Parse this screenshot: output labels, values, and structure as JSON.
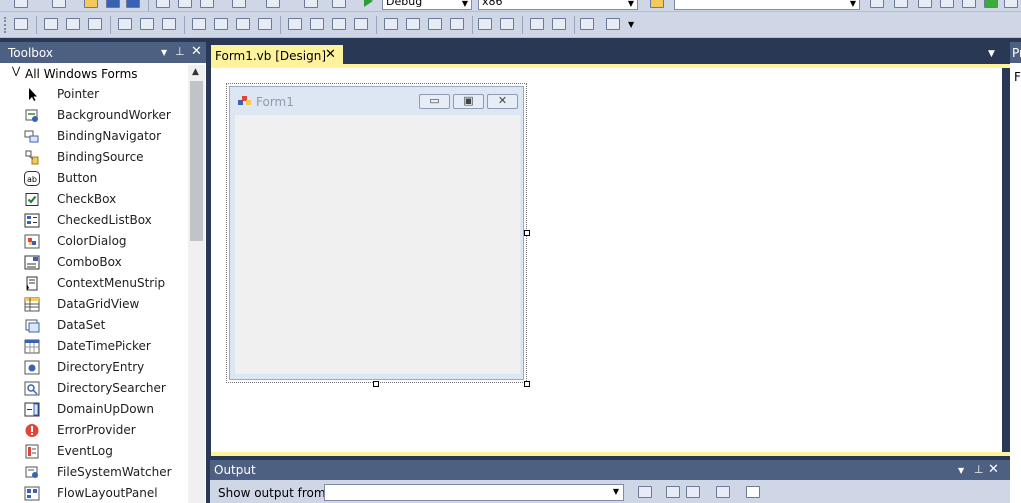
{
  "colors": {
    "accent_tab": "#fff29d",
    "panel_header": "#4d6082",
    "chrome": "#293955",
    "toolbar": "#cfd6e5"
  },
  "toolbar": {
    "config_combo": "Debug",
    "platform_combo": "x86",
    "search_combo": ""
  },
  "toolbox": {
    "title": "Toolbox",
    "group": "All Windows Forms",
    "items": [
      {
        "label": "Pointer",
        "icon": "pointer-icon"
      },
      {
        "label": "BackgroundWorker",
        "icon": "backgroundworker-icon"
      },
      {
        "label": "BindingNavigator",
        "icon": "bindingnavigator-icon"
      },
      {
        "label": "BindingSource",
        "icon": "bindingsource-icon"
      },
      {
        "label": "Button",
        "icon": "button-icon"
      },
      {
        "label": "CheckBox",
        "icon": "checkbox-icon"
      },
      {
        "label": "CheckedListBox",
        "icon": "checkedlistbox-icon"
      },
      {
        "label": "ColorDialog",
        "icon": "colordialog-icon"
      },
      {
        "label": "ComboBox",
        "icon": "combobox-icon"
      },
      {
        "label": "ContextMenuStrip",
        "icon": "contextmenustrip-icon"
      },
      {
        "label": "DataGridView",
        "icon": "datagridview-icon"
      },
      {
        "label": "DataSet",
        "icon": "dataset-icon"
      },
      {
        "label": "DateTimePicker",
        "icon": "datetimepicker-icon"
      },
      {
        "label": "DirectoryEntry",
        "icon": "directoryentry-icon"
      },
      {
        "label": "DirectorySearcher",
        "icon": "directorysearcher-icon"
      },
      {
        "label": "DomainUpDown",
        "icon": "domainupdown-icon"
      },
      {
        "label": "ErrorProvider",
        "icon": "errorprovider-icon"
      },
      {
        "label": "EventLog",
        "icon": "eventlog-icon"
      },
      {
        "label": "FileSystemWatcher",
        "icon": "filesystemwatcher-icon"
      },
      {
        "label": "FlowLayoutPanel",
        "icon": "flowlayoutpanel-icon"
      }
    ]
  },
  "document": {
    "tab_label": "Form1.vb [Design]",
    "form_title": "Form1"
  },
  "right_panel": {
    "title": "Pr",
    "first_char": "F"
  },
  "output": {
    "title": "Output",
    "show_label": "Show output from:",
    "source_value": ""
  }
}
